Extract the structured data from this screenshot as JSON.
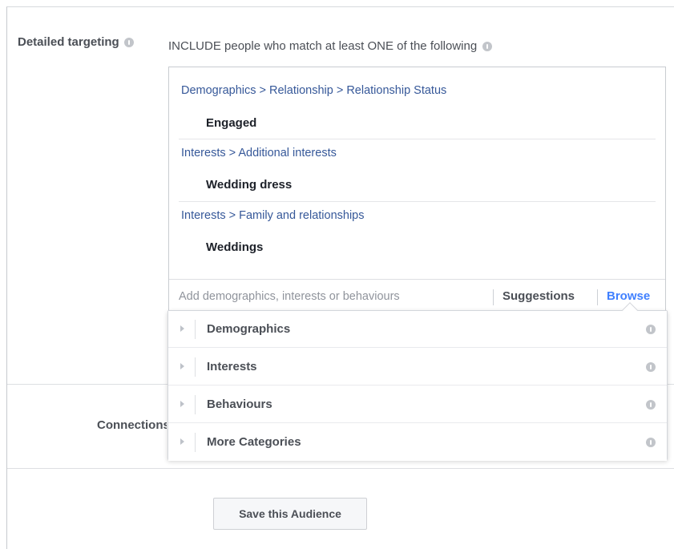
{
  "detailed_targeting": {
    "label": "Detailed targeting",
    "include_title": "INCLUDE people who match at least ONE of the following",
    "groups": [
      {
        "path": "Demographics > Relationship > Relationship Status",
        "value": "Engaged"
      },
      {
        "path": "Interests > Additional interests",
        "value": "Wedding dress"
      },
      {
        "path": "Interests > Family and relationships",
        "value": "Weddings"
      }
    ],
    "add_placeholder": "Add demographics, interests or behaviours",
    "suggestions_label": "Suggestions",
    "browse_label": "Browse"
  },
  "browse_menu": {
    "categories": [
      "Demographics",
      "Interests",
      "Behaviours",
      "More Categories"
    ]
  },
  "connections": {
    "label": "Connections"
  },
  "save_button": {
    "label": "Save this Audience"
  },
  "colors": {
    "link": "#365899",
    "browse_active": "#4080ff",
    "text": "#4b4f56"
  }
}
